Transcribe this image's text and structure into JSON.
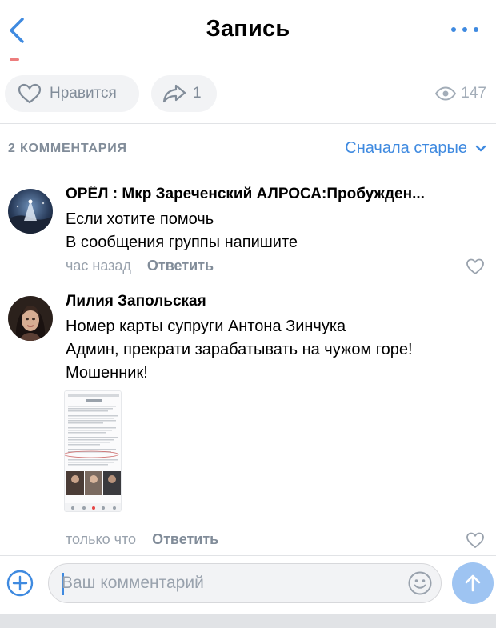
{
  "header": {
    "title": "Запись"
  },
  "actions": {
    "like_label": "Нравится",
    "share_count": "1",
    "views_count": "147"
  },
  "comments_section": {
    "count_label": "2 КОММЕНТАРИЯ",
    "sort_label": "Сначала старые"
  },
  "comments": [
    {
      "author": "ОРЁЛ : Мкр Зареченский АЛРОСА:Пробужден...",
      "lines": [
        "Если хотите помочь",
        "В сообщения группы напишите"
      ],
      "time": "час назад",
      "reply_label": "Ответить"
    },
    {
      "author": "Лилия Запольская",
      "lines": [
        "Номер карты супруги Антона Зинчука",
        "Админ, прекрати зарабатывать на чужом горе!",
        "Мошенник!"
      ],
      "time": "только что",
      "reply_label": "Ответить"
    }
  ],
  "composer": {
    "placeholder": "Ваш комментарий"
  },
  "colors": {
    "accent": "#3f8ae0",
    "secondary_text": "#818c99",
    "pill_bg": "#f2f3f5",
    "send_button": "#9ec4f2"
  },
  "icons": {
    "back": "chevron-left-icon",
    "more": "more-dots-icon",
    "like": "heart-icon",
    "share": "share-arrow-icon",
    "views": "eye-icon",
    "sort": "chevron-down-icon",
    "attach": "plus-circle-icon",
    "emoji": "smile-icon",
    "send": "arrow-up-icon"
  }
}
